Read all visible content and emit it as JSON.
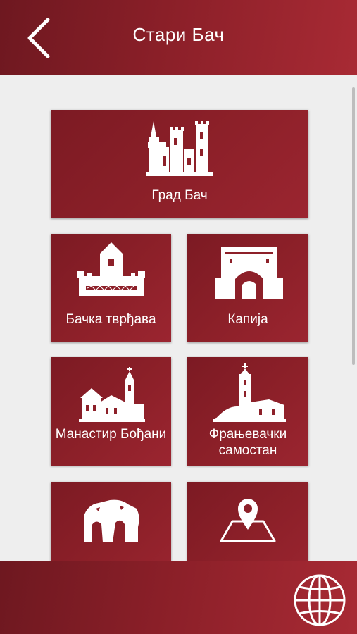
{
  "header": {
    "title": "Стари Бач",
    "back_icon": "chevron-left-icon"
  },
  "tiles": [
    {
      "label": "Град Бач",
      "icon": "castle-icon"
    },
    {
      "label": "Бачка тврђава",
      "icon": "fortress-tower-icon"
    },
    {
      "label": "Капија",
      "icon": "gate-icon"
    },
    {
      "label": "Манастир Бођани",
      "icon": "monastery-icon"
    },
    {
      "label": "Фрањевачки самостан",
      "icon": "franciscan-monastery-icon"
    },
    {
      "label": "",
      "icon": "ruins-icon"
    },
    {
      "label": "",
      "icon": "map-pin-icon"
    }
  ],
  "footer": {
    "language_icon": "globe-icon"
  },
  "colors": {
    "primary": "#8a1f28",
    "primary_dark": "#6e1820",
    "primary_light": "#a82a34",
    "background": "#eeeeee",
    "text_on_primary": "#ffffff"
  }
}
